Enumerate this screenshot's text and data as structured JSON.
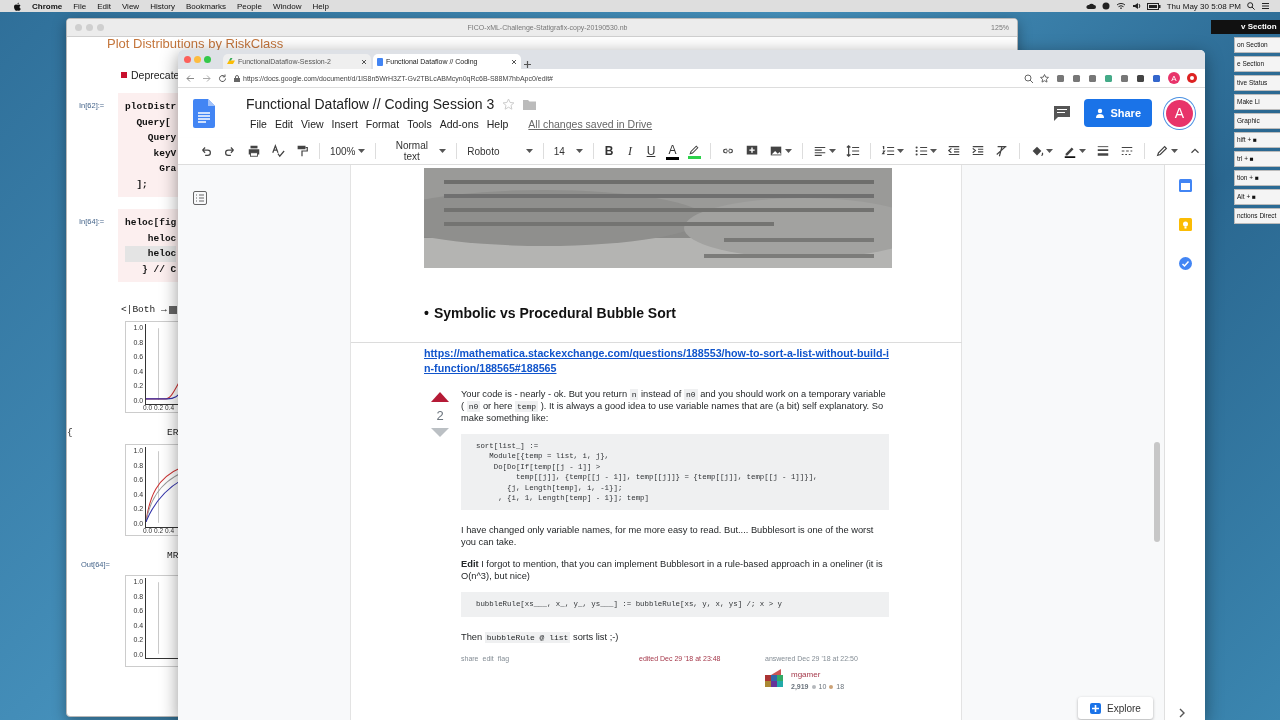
{
  "menubar": {
    "app": "Chrome",
    "menus": [
      "File",
      "Edit",
      "View",
      "History",
      "Bookmarks",
      "People",
      "Window",
      "Help"
    ],
    "clock": "Thu May 30  5:08 PM"
  },
  "notebook": {
    "title": "FICO-xML-Challenge-Statigrafix-copy-20190530.nb",
    "zoom": "125%",
    "heading": "Plot Distributions by RiskClass",
    "note": "Deprecate",
    "cells": [
      {
        "label": "In[62]:=",
        "lines": [
          {
            "text": "plotDistr",
            "highlighted": false
          },
          {
            "text": "  Query[",
            "highlighted": false
          },
          {
            "text": "    Query",
            "highlighted": false
          },
          {
            "text": "     keyV",
            "highlighted": false
          },
          {
            "text": "      Gra",
            "highlighted": false
          },
          {
            "text": "  ];",
            "highlighted": false
          }
        ]
      },
      {
        "label": "In[64]:=",
        "lines": [
          {
            "text": "heloc[fig",
            "highlighted": false
          },
          {
            "text": "    heloc",
            "highlighted": false
          },
          {
            "text": "    heloc",
            "highlighted": true
          },
          {
            "text": "   } // C",
            "highlighted": false
          }
        ]
      }
    ],
    "output": [
      {
        "kind": "legend",
        "text": "<|Both →"
      },
      {
        "kind": "plot",
        "yticks": [
          "1.0",
          "0.8",
          "0.6",
          "0.4",
          "0.2",
          "0.0"
        ],
        "xticks": [
          "0.0",
          "0.2",
          "0.4"
        ]
      },
      {
        "kind": "caption",
        "mark": "{",
        "text": "ER"
      },
      {
        "kind": "plot",
        "yticks": [
          "1.0",
          "0.8",
          "0.6",
          "0.4",
          "0.2",
          "0.0"
        ],
        "xticks": [
          "0.0",
          "0.2",
          "0.4"
        ]
      },
      {
        "kind": "caption",
        "label": "Out[64]=",
        "text": "MR"
      },
      {
        "kind": "plot",
        "yticks": [
          "1.0",
          "0.8",
          "0.6",
          "0.4",
          "0.2",
          "0.0"
        ]
      }
    ]
  },
  "palette": {
    "header": "v Section",
    "items": [
      "on Section",
      "e Section",
      "tive Status",
      "Make Li",
      "Graphic",
      "hift + ■",
      "trl + ■",
      "tion + ■",
      "Alt + ■",
      "nctions Direct"
    ]
  },
  "browser": {
    "tabs": [
      {
        "title": "FunctionalDataflow-Session-2",
        "selected": false
      },
      {
        "title": "Functional Dataflow // Coding",
        "selected": true
      }
    ],
    "url": "https://docs.google.com/document/d/1lS8n5WrH3ZT-Gv2TBLcABMcyn0qRc6B-S88M7hbApc0/edit#",
    "profile": "A"
  },
  "docs": {
    "title": "Functional Dataflow // Coding Session 3",
    "menus": [
      "File",
      "Edit",
      "View",
      "Insert",
      "Format",
      "Tools",
      "Add-ons",
      "Help"
    ],
    "save_status": "All changes saved in Drive",
    "share": "Share",
    "avatar": "A",
    "toolbar": {
      "zoom": "100%",
      "style": "Normal text",
      "font": "Roboto",
      "size": "14",
      "format": [
        "B",
        "I",
        "U",
        "A"
      ]
    },
    "explore": "Explore"
  },
  "document": {
    "heading": {
      "bullet": "•",
      "text": "Symbolic vs Procedural Bubble Sort"
    },
    "link": "https://mathematica.stackexchange.com/questions/188553/how-to-sort-a-list-without-build-in-function/188565#188565",
    "answer": {
      "votes": "2",
      "blocks": [
        {
          "kind": "para",
          "parts": [
            {
              "text": "Your code is - nearly - ok. But you return "
            },
            {
              "code": "n"
            },
            {
              "text": " instead of "
            },
            {
              "code": "n0"
            },
            {
              "text": " and you should work on a temporary variable ( "
            },
            {
              "code": "n0"
            },
            {
              "text": " or here "
            },
            {
              "code": "temp"
            },
            {
              "text": " ). It is always a good idea to use variable names that are (a bit) self explanatory. So make something like:"
            }
          ]
        },
        {
          "kind": "code",
          "lines": [
            "sort[list_] :=",
            "   Module[{temp = list, i, j},",
            "    Do[Do[If[temp[[j - 1]] >",
            "         temp[[j]], {temp[[j - 1]], temp[[j]]} = {temp[[j]], temp[[j - 1]]}],",
            "       {j, Length[temp], i, -1}];",
            "     , {i, 1, Length[temp] - 1}]; temp]"
          ]
        },
        {
          "kind": "para",
          "parts": [
            {
              "text": "I have changed only variable names, for me more easy to read. But.... Bubblesort is one of the worst you can take."
            }
          ]
        },
        {
          "kind": "para",
          "parts": [
            {
              "text": "**Edit** I forgot to mention, that you can implement Bubblesort in a rule-based approach in a oneliner (it is O(n^3), but nice)"
            }
          ]
        },
        {
          "kind": "code",
          "lines": [
            "bubbleRule[xs___, x_, y_, ys___] := bubbleRule[xs, y, x, ys] /; x > y"
          ]
        },
        {
          "kind": "para",
          "parts": [
            {
              "text": "Then "
            },
            {
              "code": "bubbleRule @ list"
            },
            {
              "text": " sorts list ;-)"
            }
          ]
        }
      ],
      "actions": [
        "share",
        "edit",
        "flag"
      ],
      "edited": "edited Dec 29 '18 at 23:48",
      "answered": "answered Dec 29 '18 at 22:50",
      "user": {
        "name": "mgamer",
        "reputation": "2,919",
        "badges": [
          {
            "count": "10",
            "color": "#b4b8bc"
          },
          {
            "count": "18",
            "color": "#cda277"
          }
        ]
      }
    }
  }
}
